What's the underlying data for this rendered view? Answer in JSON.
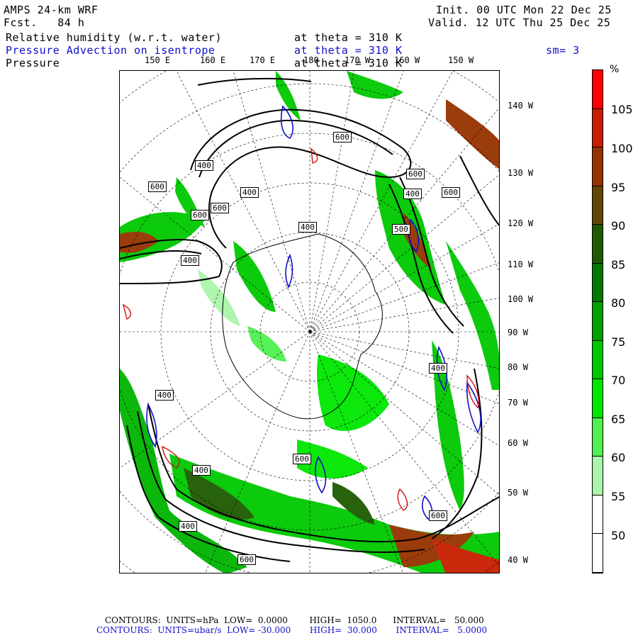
{
  "header": {
    "model": "AMPS 24-km WRF",
    "forecast": "Fcst.   84 h",
    "init": "Init. 00 UTC Mon 22 Dec 25",
    "valid": "Valid. 12 UTC Thu 25 Dec 25",
    "field1_name": "Relative humidity (w.r.t. water)",
    "field1_level": "at theta = 310 K",
    "field2_name": "Pressure Advection on isentrope",
    "field2_level": "at theta = 310 K",
    "field2_smooth": "sm= 3",
    "field3_name": "Pressure",
    "field3_level": "at theta = 310 K"
  },
  "map_labels": {
    "lon_top": [
      "150 E",
      "160 E",
      "170 E",
      "180",
      "170 W",
      "160 W",
      "150 W"
    ],
    "lon_right": [
      "140 W",
      "130 W",
      "120 W",
      "110 W",
      "100 W",
      "90 W",
      "80 W",
      "70 W",
      "60 W",
      "50 W",
      "40 W"
    ],
    "contour_labels": [
      "600",
      "400",
      "600",
      "400",
      "400",
      "400",
      "600",
      "600",
      "600",
      "500",
      "400",
      "400",
      "400",
      "400",
      "600",
      "400",
      "600",
      "600",
      "600"
    ]
  },
  "colorbar": {
    "unit": "%",
    "labels": [
      "105",
      "100",
      "95",
      "90",
      "85",
      "80",
      "75",
      "70",
      "65",
      "60",
      "55",
      "50"
    ],
    "colors": [
      "#ff0000",
      "#c81e00",
      "#963200",
      "#644600",
      "#1e5a00",
      "#007800",
      "#00a000",
      "#00c800",
      "#00e600",
      "#50f050",
      "#aaf5aa",
      "#ffffff",
      "#ffffff"
    ]
  },
  "footer": {
    "line1": "CONTOURS:  UNITS=hPa  LOW=  0.0000        HIGH=  1050.0      INTERVAL=   50.000",
    "line2": "CONTOURS:  UNITS=ubar/s  LOW= -30.000       HIGH=  30.000       INTERVAL=   5.0000"
  }
}
